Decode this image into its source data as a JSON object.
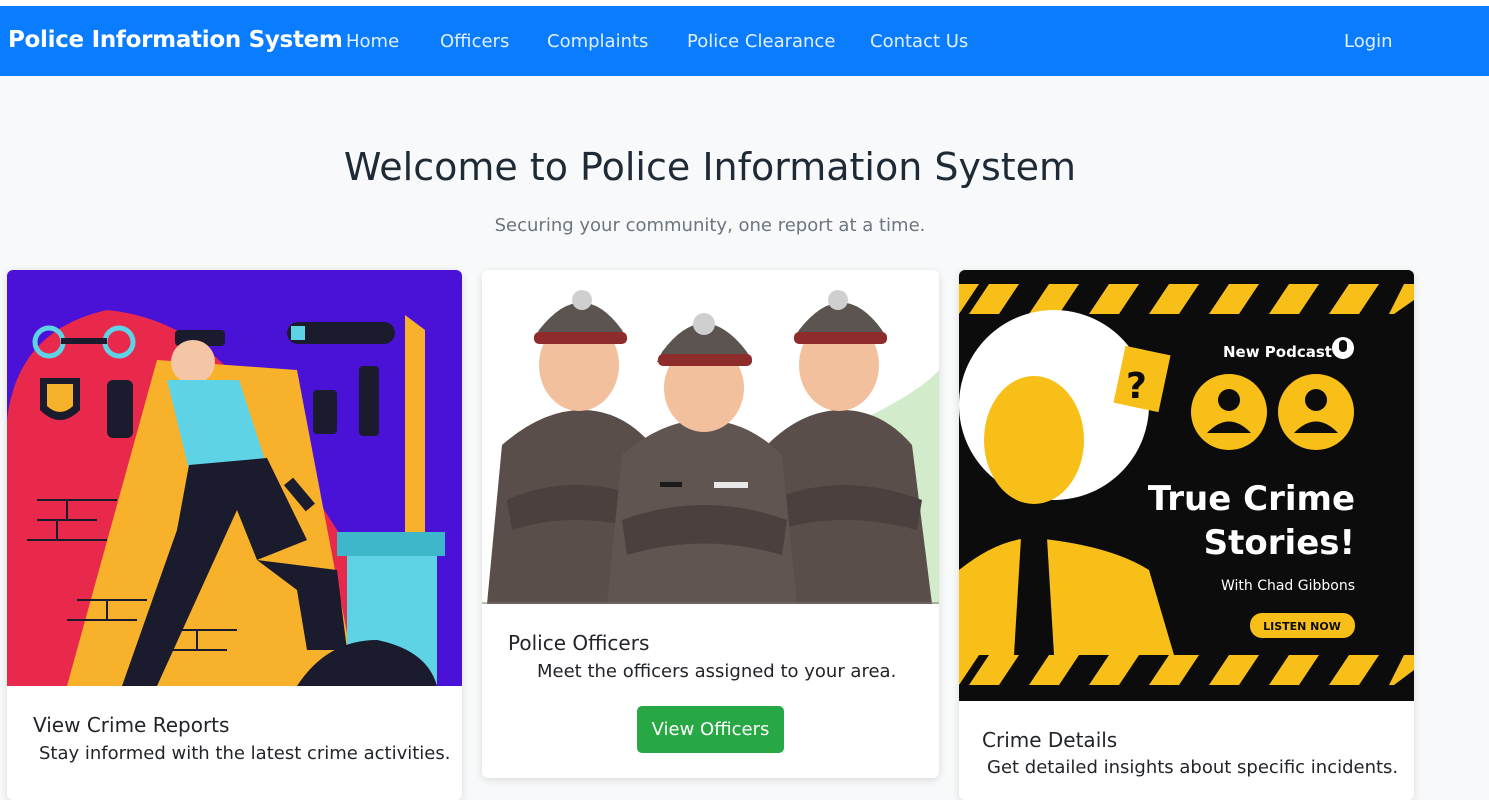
{
  "navbar": {
    "brand": "Police Information System",
    "links": [
      "Home",
      "Officers",
      "Complaints",
      "Police Clearance",
      "Contact Us"
    ],
    "login": "Login",
    "accent": "#0a7cff"
  },
  "hero": {
    "title": "Welcome to Police Information System",
    "subtitle": "Securing your community, one report at a time."
  },
  "cards": [
    {
      "image": "police-officer-illustration",
      "title": "View Crime Reports",
      "text": "Stay informed with the latest crime activities."
    },
    {
      "image": "three-officers-illustration",
      "title": "Police Officers",
      "text": "Meet the officers assigned to your area.",
      "button": "View Officers",
      "button_color": "#28a745"
    },
    {
      "image": "true-crime-podcast-poster",
      "title": "Crime Details",
      "text": "Get detailed insights about specific incidents.",
      "poster": {
        "badge": "New Podcast",
        "headline_1": "True Crime",
        "headline_2": "Stories!",
        "byline": "With Chad Gibbons",
        "cta": "LISTEN NOW"
      }
    }
  ]
}
